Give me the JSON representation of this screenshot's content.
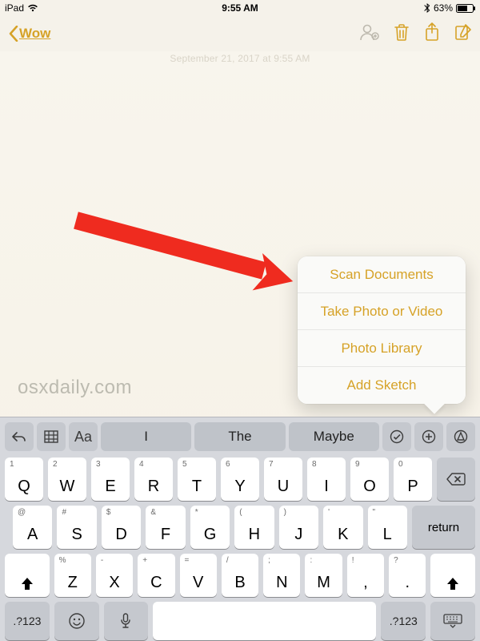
{
  "status": {
    "device": "iPad",
    "time": "9:55 AM",
    "battery_pct": "63%"
  },
  "nav": {
    "back_label": "Wow"
  },
  "note": {
    "timestamp": "September 21, 2017 at 9:55 AM"
  },
  "watermark": "osxdaily.com",
  "popover": {
    "items": [
      "Scan Documents",
      "Take Photo or Video",
      "Photo Library",
      "Add Sketch"
    ]
  },
  "suggestions": [
    "I",
    "The",
    "Maybe"
  ],
  "keys": {
    "row1": [
      {
        "main": "Q",
        "alt": "1"
      },
      {
        "main": "W",
        "alt": "2"
      },
      {
        "main": "E",
        "alt": "3"
      },
      {
        "main": "R",
        "alt": "4"
      },
      {
        "main": "T",
        "alt": "5"
      },
      {
        "main": "Y",
        "alt": "6"
      },
      {
        "main": "U",
        "alt": "7"
      },
      {
        "main": "I",
        "alt": "8"
      },
      {
        "main": "O",
        "alt": "9"
      },
      {
        "main": "P",
        "alt": "0"
      }
    ],
    "row2": [
      {
        "main": "A",
        "alt": "@"
      },
      {
        "main": "S",
        "alt": "#"
      },
      {
        "main": "D",
        "alt": "$"
      },
      {
        "main": "F",
        "alt": "&"
      },
      {
        "main": "G",
        "alt": "*"
      },
      {
        "main": "H",
        "alt": "("
      },
      {
        "main": "J",
        "alt": ")"
      },
      {
        "main": "K",
        "alt": "'"
      },
      {
        "main": "L",
        "alt": "\""
      }
    ],
    "row3": [
      {
        "main": "Z",
        "alt": "%"
      },
      {
        "main": "X",
        "alt": "-"
      },
      {
        "main": "C",
        "alt": "+"
      },
      {
        "main": "V",
        "alt": "="
      },
      {
        "main": "B",
        "alt": "/"
      },
      {
        "main": "N",
        "alt": ";"
      },
      {
        "main": "M",
        "alt": ":"
      }
    ],
    "punct": {
      "main": ",",
      "alt": "!"
    },
    "period": {
      "main": ".",
      "alt": "?"
    },
    "mode_label": ".?123",
    "return_label": "return"
  }
}
